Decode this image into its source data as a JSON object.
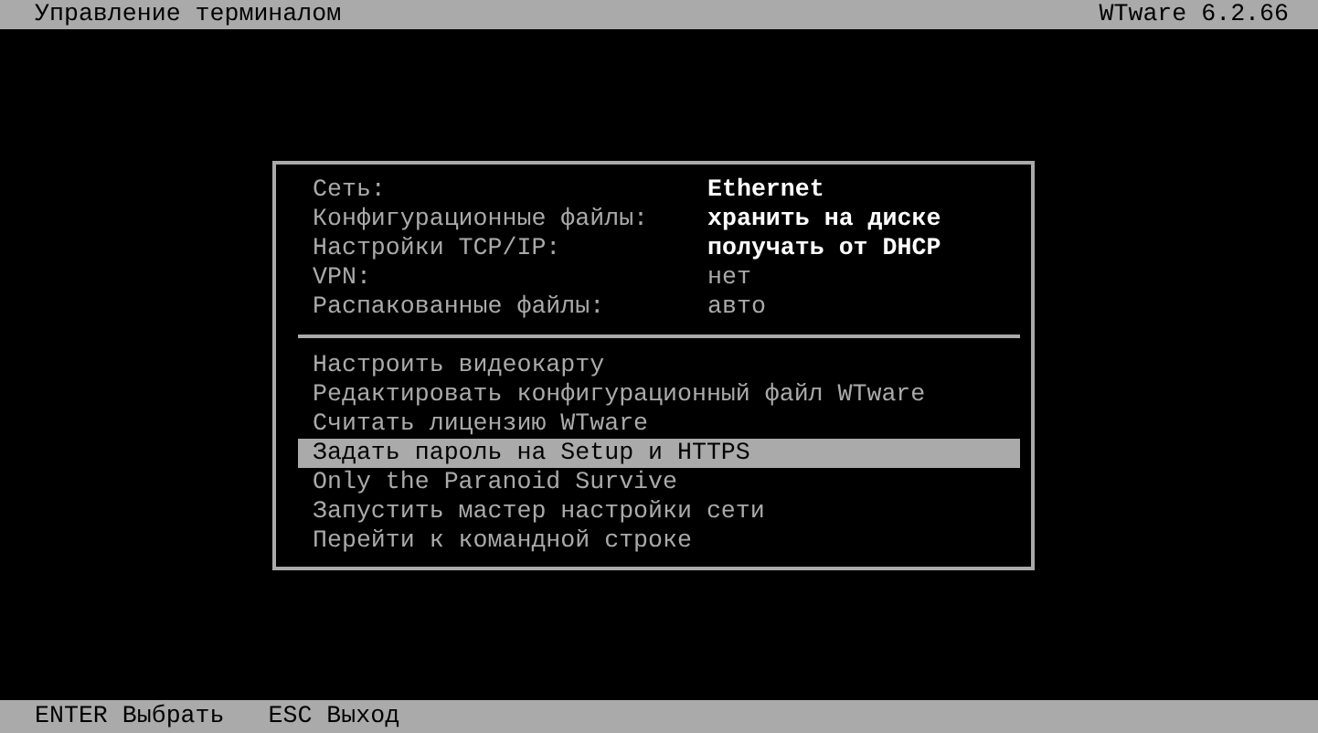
{
  "title_bar": {
    "title": "Управление терминалом",
    "version": "WTware 6.2.66"
  },
  "settings": [
    {
      "label": "Сеть:",
      "value": "Ethernet",
      "bright": true
    },
    {
      "label": "Конфигурационные файлы:",
      "value": "хранить на диске",
      "bright": true
    },
    {
      "label": "Настройки TCP/IP:",
      "value": "получать от DHCP",
      "bright": true
    },
    {
      "label": "VPN:",
      "value": "нет",
      "bright": false
    },
    {
      "label": "Распакованные файлы:",
      "value": "авто",
      "bright": false
    }
  ],
  "menu": [
    {
      "label": "Настроить видеокарту",
      "selected": false
    },
    {
      "label": "Редактировать конфигурационный файл WTware",
      "selected": false
    },
    {
      "label": "Считать лицензию WTware",
      "selected": false
    },
    {
      "label": "Задать пароль на Setup и HTTPS",
      "selected": true
    },
    {
      "label": "Only the Paranoid Survive",
      "selected": false
    },
    {
      "label": "Запустить мастер настройки сети",
      "selected": false
    },
    {
      "label": "Перейти к командной строке",
      "selected": false
    }
  ],
  "status_bar": [
    {
      "key": "ENTER",
      "action": "Выбрать"
    },
    {
      "key": "ESC",
      "action": "Выход"
    }
  ]
}
